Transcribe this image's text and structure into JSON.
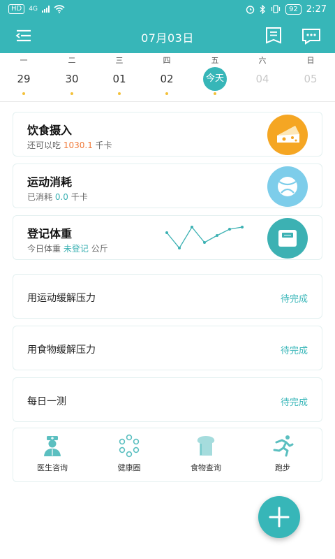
{
  "status_bar": {
    "left_badge": "HD",
    "network": "4G",
    "battery": "92",
    "time": "2:27"
  },
  "navbar": {
    "title": "07月03日"
  },
  "week": {
    "weekdays": [
      "一",
      "二",
      "三",
      "四",
      "五",
      "六",
      "日"
    ],
    "days": [
      {
        "num": "29",
        "dot": true,
        "state": "past"
      },
      {
        "num": "30",
        "dot": true,
        "state": "past"
      },
      {
        "num": "01",
        "dot": true,
        "state": "past"
      },
      {
        "num": "02",
        "dot": true,
        "state": "past"
      },
      {
        "num": "03",
        "dot": true,
        "state": "today"
      },
      {
        "num": "04",
        "dot": false,
        "state": "future"
      },
      {
        "num": "05",
        "dot": false,
        "state": "future"
      }
    ],
    "today_label": "今天"
  },
  "cards": {
    "diet": {
      "title": "饮食摄入",
      "sub_prefix": "还可以吃",
      "value": "1030.1",
      "unit": "千卡",
      "icon": "cheese-icon",
      "color": "#f5a623"
    },
    "exercise": {
      "title": "运动消耗",
      "sub_prefix": "已消耗",
      "value": "0.0",
      "unit": "千卡",
      "icon": "ball-icon",
      "color": "#7dcdea"
    },
    "weight": {
      "title": "登记体重",
      "sub_prefix": "今日体重",
      "value": "未登记",
      "unit": "公斤",
      "icon": "scale-icon",
      "color": "#3cb1b3"
    }
  },
  "tasks": [
    {
      "label": "用运动缓解压力",
      "status": "待完成"
    },
    {
      "label": "用食物缓解压力",
      "status": "待完成"
    },
    {
      "label": "每日一测",
      "status": "待完成"
    }
  ],
  "shortcuts": [
    {
      "label": "医生咨询",
      "icon": "doctor-icon"
    },
    {
      "label": "健康圈",
      "icon": "circle-dots-icon"
    },
    {
      "label": "食物查询",
      "icon": "bread-icon"
    },
    {
      "label": "跑步",
      "icon": "runner-icon"
    }
  ],
  "colors": {
    "primary": "#37b6b8",
    "accent_orange": "#f07a3a",
    "dot_yellow": "#f3c13a"
  }
}
